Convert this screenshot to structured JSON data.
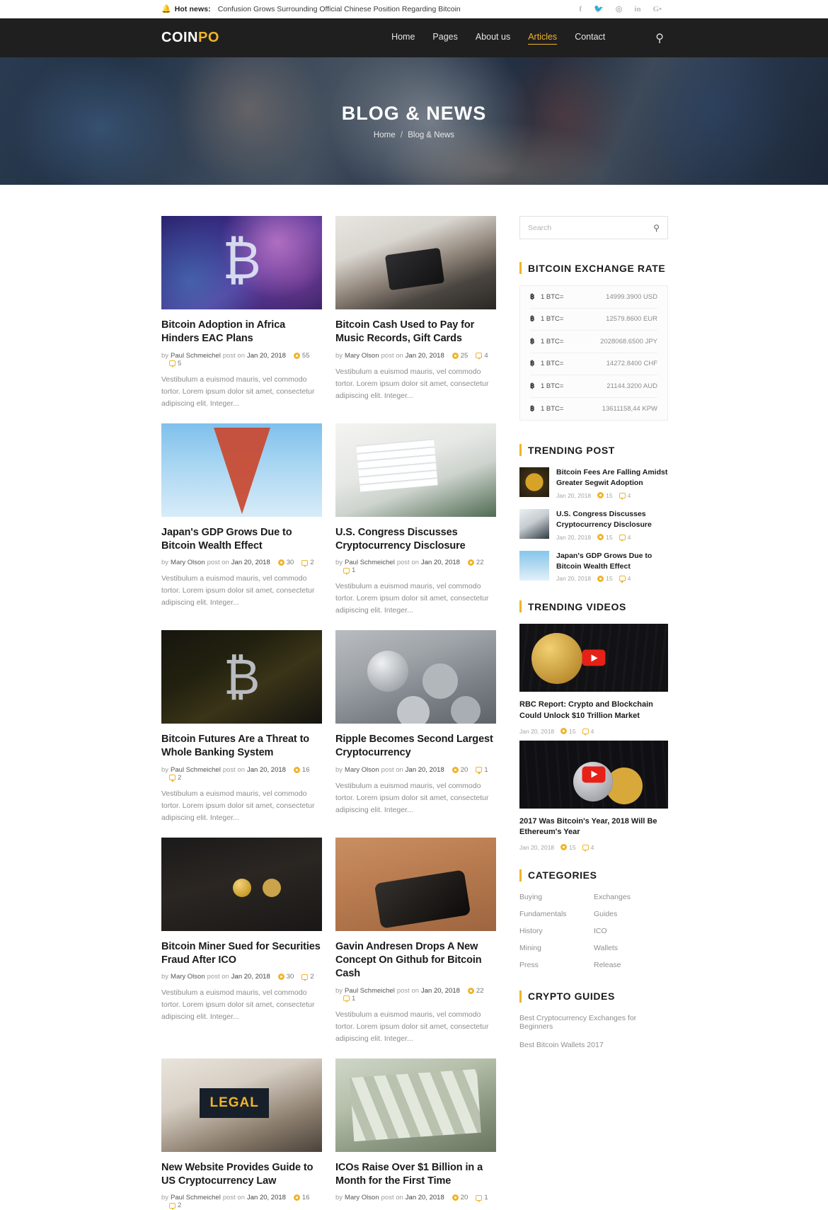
{
  "topbar": {
    "hot_label": "Hot news:",
    "hot_text": "Confusion Grows Surrounding Official Chinese Position Regarding Bitcoin",
    "icon": "bell-icon",
    "social": [
      "f",
      "t",
      "p",
      "in",
      "G+"
    ]
  },
  "header": {
    "logo_white": "COIN",
    "logo_yellow": "PO",
    "nav": [
      {
        "label": "Home",
        "active": false
      },
      {
        "label": "Pages",
        "active": false
      },
      {
        "label": "About us",
        "active": false
      },
      {
        "label": "Articles",
        "active": true
      },
      {
        "label": "Contact",
        "active": false
      }
    ],
    "search_icon": "search-icon"
  },
  "hero": {
    "title": "BLOG & NEWS",
    "crumb_home": "Home",
    "crumb_sep": "/",
    "crumb_current": "Blog & News"
  },
  "articles": [
    {
      "title": "Bitcoin Adoption in Africa Hinders EAC Plans",
      "by": "by",
      "author": "Paul Schmeichel",
      "posted": "post on",
      "date": "Jan 20, 2018",
      "views": "55",
      "comments": "5",
      "excerpt": "Vestibulum a euismod mauris, vel commodo tortor. Lorem ipsum dolor sit amet, consectetur adipiscing elit. Integer...",
      "photo": "p-space"
    },
    {
      "title": "Bitcoin Cash Used to Pay for Music Records, Gift Cards",
      "by": "by",
      "author": "Mary Olson",
      "posted": "post on",
      "date": "Jan 20, 2018",
      "views": "25",
      "comments": "4",
      "excerpt": "Vestibulum a euismod mauris, vel commodo tortor. Lorem ipsum dolor sit amet, consectetur adipiscing elit. Integer...",
      "photo": "p-pos"
    },
    {
      "title": "Japan's GDP Grows Due to Bitcoin Wealth Effect",
      "by": "by",
      "author": "Mary Olson",
      "posted": "post on",
      "date": "Jan 20, 2018",
      "views": "30",
      "comments": "2",
      "excerpt": "Vestibulum a euismod mauris, vel commodo tortor. Lorem ipsum dolor sit amet, consectetur adipiscing elit. Integer...",
      "photo": "p-tower"
    },
    {
      "title": "U.S. Congress Discusses Cryptocurrency Disclosure",
      "by": "by",
      "author": "Paul Schmeichel",
      "posted": "post on",
      "date": "Jan 20, 2018",
      "views": "22",
      "comments": "1",
      "excerpt": "Vestibulum a euismod mauris, vel commodo tortor. Lorem ipsum dolor sit amet, consectetur adipiscing elit. Integer...",
      "photo": "p-chart"
    },
    {
      "title": "Bitcoin Futures Are a Threat to Whole Banking System",
      "by": "by",
      "author": "Paul Schmeichel",
      "posted": "post on",
      "date": "Jan 20, 2018",
      "views": "16",
      "comments": "2",
      "excerpt": "Vestibulum a euismod mauris, vel commodo tortor. Lorem ipsum dolor sit amet, consectetur adipiscing elit. Integer...",
      "photo": "p-circuit"
    },
    {
      "title": "Ripple Becomes Second Largest Cryptocurrency",
      "by": "by",
      "author": "Mary Olson",
      "posted": "post on",
      "date": "Jan 20, 2018",
      "views": "20",
      "comments": "1",
      "excerpt": "Vestibulum a euismod mauris, vel commodo tortor. Lorem ipsum dolor sit amet, consectetur adipiscing elit. Integer...",
      "photo": "p-ripple"
    },
    {
      "title": "Bitcoin Miner Sued for Securities Fraud After ICO",
      "by": "by",
      "author": "Mary Olson",
      "posted": "post on",
      "date": "Jan 20, 2018",
      "views": "30",
      "comments": "2",
      "excerpt": "Vestibulum a euismod mauris, vel commodo tortor. Lorem ipsum dolor sit amet, consectetur adipiscing elit. Integer...",
      "photo": "p-eyes"
    },
    {
      "title": "Gavin Andresen Drops A New Concept On Github for Bitcoin Cash",
      "by": "by",
      "author": "Paul Schmeichel",
      "posted": "post on",
      "date": "Jan 20, 2018",
      "views": "22",
      "comments": "1",
      "excerpt": "Vestibulum a euismod mauris, vel commodo tortor. Lorem ipsum dolor sit amet, consectetur adipiscing elit. Integer...",
      "photo": "p-phone"
    },
    {
      "title": "New Website Provides Guide to US Cryptocurrency Law",
      "by": "by",
      "author": "Paul Schmeichel",
      "posted": "post on",
      "date": "Jan 20, 2018",
      "views": "16",
      "comments": "2",
      "excerpt": "",
      "photo": "p-legal"
    },
    {
      "title": "ICOs Raise Over $1 Billion in a Month for the First Time",
      "by": "by",
      "author": "Mary Olson",
      "posted": "post on",
      "date": "Jan 20, 2018",
      "views": "20",
      "comments": "1",
      "excerpt": "",
      "photo": "p-money"
    }
  ],
  "sidebar": {
    "search_placeholder": "Search",
    "search_icon": "search-icon",
    "rate_title": "BITCOIN EXCHANGE RATE",
    "rates": [
      {
        "symbol": "฿",
        "label": "1 BTC=",
        "value": "14999.3900 USD"
      },
      {
        "symbol": "฿",
        "label": "1 BTC=",
        "value": "12579.8600 EUR"
      },
      {
        "symbol": "฿",
        "label": "1 BTC=",
        "value": "2028068.6500 JPY"
      },
      {
        "symbol": "฿",
        "label": "1 BTC=",
        "value": "14272.8400 CHF"
      },
      {
        "symbol": "฿",
        "label": "1 BTC=",
        "value": "21144.3200 AUD"
      },
      {
        "symbol": "฿",
        "label": "1 BTC=",
        "value": "13611158,44 KPW"
      }
    ],
    "trending_title": "TRENDING POST",
    "trending": [
      {
        "title": "Bitcoin Fees Are Falling Amidst Greater Segwit Adoption",
        "date": "Jan 20, 2018",
        "views": "15",
        "comments": "4",
        "photo": "t-fees"
      },
      {
        "title": "U.S. Congress Discusses Cryptocurrency Disclosure",
        "date": "Jan 20, 2018",
        "views": "15",
        "comments": "4",
        "photo": "t-congress"
      },
      {
        "title": "Japan's GDP Grows Due to Bitcoin Wealth Effect",
        "date": "Jan 20, 2018",
        "views": "15",
        "comments": "4",
        "photo": "t-japan"
      }
    ],
    "videos_title": "TRENDING VIDEOS",
    "videos": [
      {
        "title": "RBC Report: Crypto and Blockchain Could Unlock $10 Trillion Market",
        "date": "Jan 20, 2018",
        "views": "15",
        "comments": "4",
        "photo": "v-trade",
        "play_icon": "play-icon"
      },
      {
        "title": "2017 Was Bitcoin's Year,  2018 Will Be Ethereum's Year",
        "date": "Jan 20, 2018",
        "views": "15",
        "comments": "4",
        "photo": "v-eth",
        "play_icon": "play-icon"
      }
    ],
    "categories_title": "CATEGORIES",
    "categories": [
      "Buying",
      "Exchanges",
      "Fundamentals",
      "Guides",
      "History",
      "ICO",
      "Mining",
      "Wallets",
      "Press",
      "Release"
    ],
    "guides_title": "CRYPTO GUIDES",
    "guides": [
      "Best Cryptocurrency Exchanges for Beginners",
      "Best Bitcoin Wallets 2017"
    ]
  },
  "colors": {
    "accent": "#f0b429",
    "header_bg": "#1f1f1f",
    "play": "#e62117"
  }
}
